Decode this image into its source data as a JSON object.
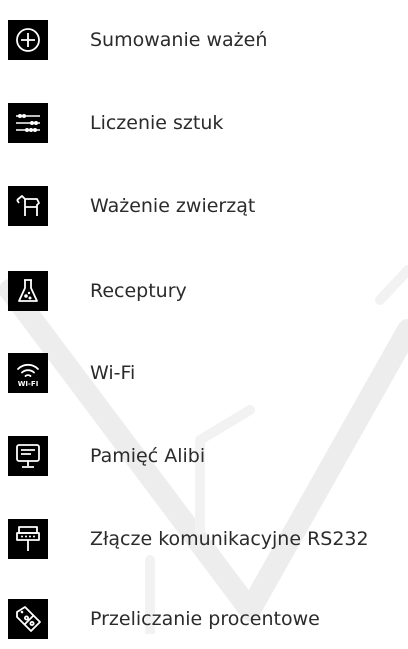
{
  "features": [
    {
      "label": "Sumowanie ważeń",
      "icon": "plus-circle-icon"
    },
    {
      "label": "Liczenie sztuk",
      "icon": "abacus-icon"
    },
    {
      "label": "Ważenie zwierząt",
      "icon": "horse-icon"
    },
    {
      "label": "Receptury",
      "icon": "flask-icon"
    },
    {
      "label": "Wi-Fi",
      "icon": "wifi-icon"
    },
    {
      "label": "Pamięć Alibi",
      "icon": "monitor-memory-icon"
    },
    {
      "label": "Złącze komunikacyjne RS232",
      "icon": "rs232-connector-icon"
    },
    {
      "label": "Przeliczanie procentowe",
      "icon": "percent-tag-icon"
    }
  ],
  "colors": {
    "icon_bg": "#000000",
    "icon_fg": "#ffffff",
    "text": "#2b2b2b",
    "watermark": "#ececec"
  }
}
